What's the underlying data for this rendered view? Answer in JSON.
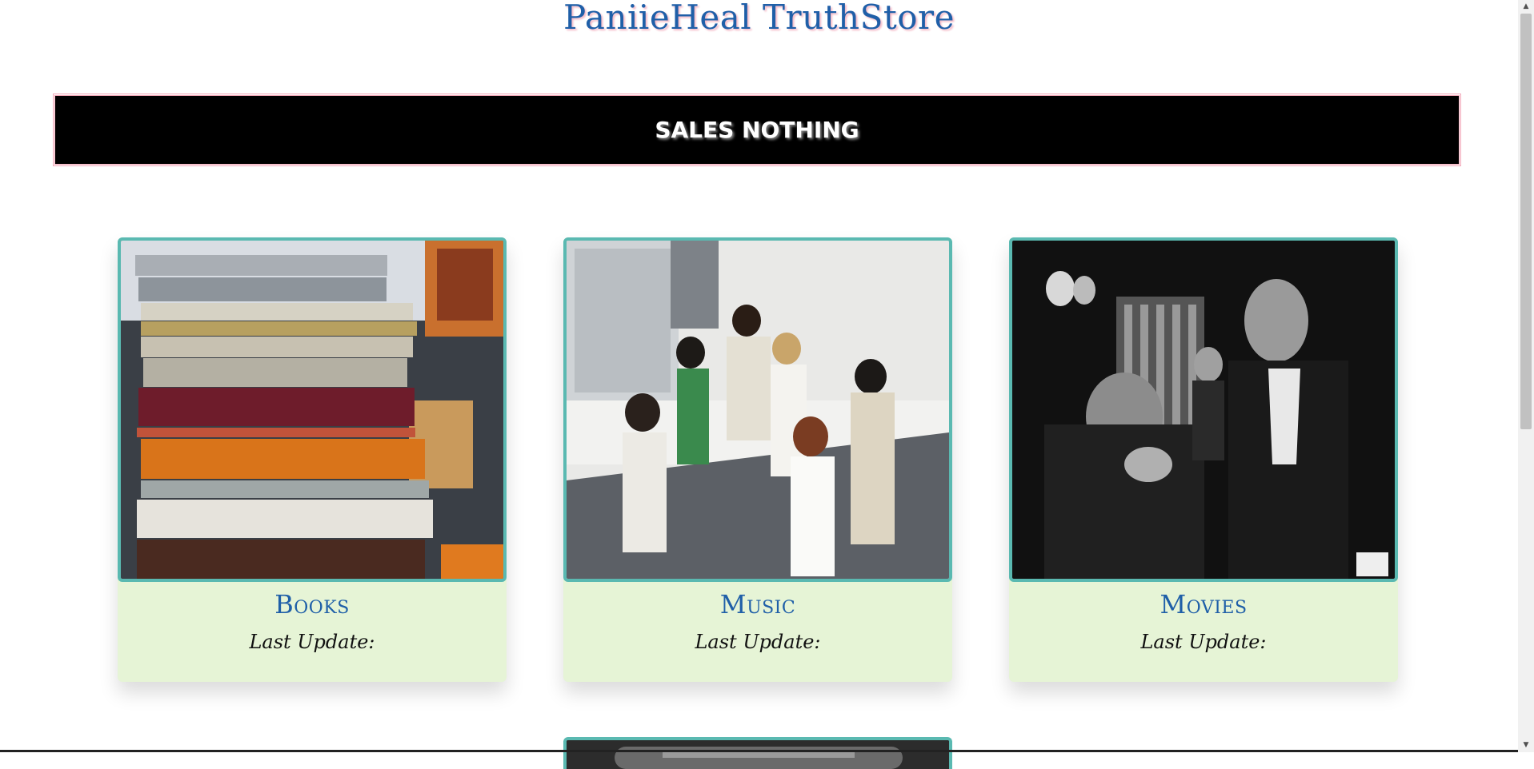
{
  "header": {
    "title": "PaniieHeal TruthStore"
  },
  "banner": {
    "text": "SALES NOTHING"
  },
  "cards": [
    {
      "title": "Books",
      "update_label": "Last Update:",
      "image": "stack-of-books-photo"
    },
    {
      "title": "Music",
      "update_label": "Last Update:",
      "image": "band-group-photo"
    },
    {
      "title": "Movies",
      "update_label": "Last Update:",
      "image": "black-and-white-film-still"
    }
  ],
  "colors": {
    "title": "#1f5fa8",
    "banner_bg": "#000000",
    "card_bg": "#e6f4d6",
    "card_border": "#5ab9b1"
  }
}
